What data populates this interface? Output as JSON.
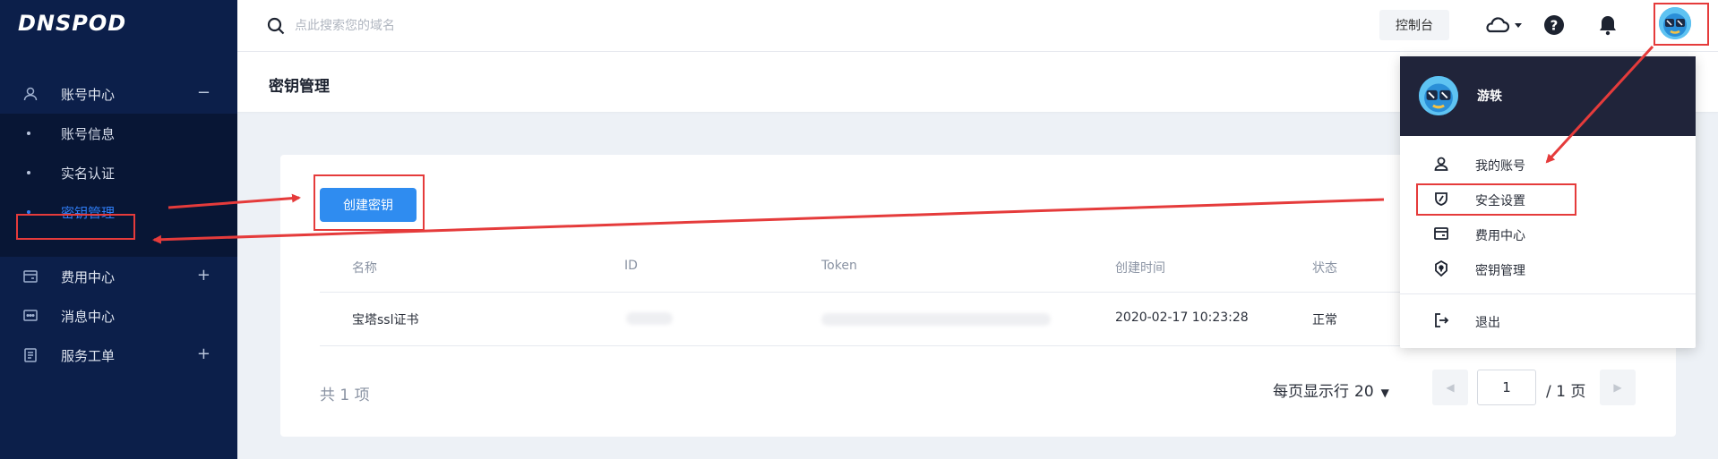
{
  "logo": "DNSPOD",
  "sidebar": {
    "groups": [
      {
        "label": "账号中心",
        "toggle": "−",
        "icon": "user-icon"
      },
      {
        "label": "费用中心",
        "toggle": "+",
        "icon": "wallet-icon"
      },
      {
        "label": "消息中心",
        "toggle": "",
        "icon": "message-icon"
      },
      {
        "label": "服务工单",
        "toggle": "+",
        "icon": "ticket-icon"
      }
    ],
    "sub_items": [
      {
        "label": "账号信息"
      },
      {
        "label": "实名认证"
      },
      {
        "label": "密钥管理",
        "active": true
      }
    ]
  },
  "header": {
    "search_placeholder": "点此搜索您的域名",
    "console_label": "控制台",
    "icons": [
      "cloud-icon",
      "help-icon",
      "bell-icon",
      "avatar"
    ]
  },
  "page": {
    "title": "密钥管理",
    "create_button": "创建密钥",
    "table": {
      "columns": [
        "名称",
        "ID",
        "Token",
        "创建时间",
        "状态"
      ],
      "rows": [
        {
          "name": "宝塔ssl证书",
          "id": "",
          "token": "",
          "created": "2020-02-17 10:23:28",
          "status": "正常"
        }
      ]
    },
    "total": "共 1 项",
    "per_page_label": "每页显示行",
    "per_page_value": "20",
    "current_page": "1",
    "page_total": "/ 1 页"
  },
  "dropdown": {
    "username": "游轶",
    "items": [
      {
        "label": "我的账号",
        "icon": "user-icon"
      },
      {
        "label": "安全设置",
        "icon": "shield-icon"
      },
      {
        "label": "费用中心",
        "icon": "wallet-icon"
      },
      {
        "label": "密钥管理",
        "icon": "key-icon"
      },
      {
        "label": "退出",
        "icon": "logout-icon"
      }
    ]
  },
  "colors": {
    "sidebar_bg": "#0c1f4a",
    "submenu_bg": "#081635",
    "accent": "#2f8cf0",
    "annotation": "#e53b3b",
    "dropdown_head": "#20243a"
  }
}
